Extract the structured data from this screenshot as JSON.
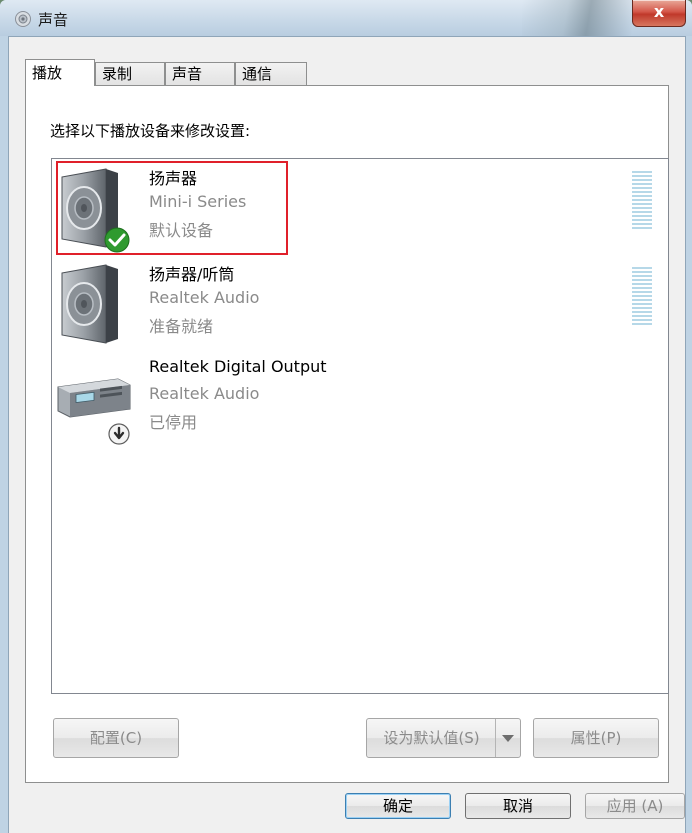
{
  "window": {
    "title": "声音",
    "close_label": "x"
  },
  "tabs": [
    {
      "label": "播放",
      "active": true
    },
    {
      "label": "录制",
      "active": false
    },
    {
      "label": "声音",
      "active": false
    },
    {
      "label": "通信",
      "active": false
    }
  ],
  "instruction": "选择以下播放设备来修改设置:",
  "devices": [
    {
      "name": "扬声器",
      "driver": "Mini-i Series",
      "status": "默认设备",
      "icon": "speaker-icon",
      "badge": "checkmark-icon",
      "selected": true
    },
    {
      "name": "扬声器/听筒",
      "driver": "Realtek Audio",
      "status": "准备就绪",
      "icon": "speaker-icon",
      "badge": null,
      "selected": false
    },
    {
      "name": "Realtek Digital Output",
      "driver": "Realtek Audio",
      "status": "已停用",
      "icon": "digital-output-icon",
      "badge": "disabled-arrow-icon",
      "selected": false
    }
  ],
  "panel_buttons": {
    "configure": "配置(C)",
    "set_default": "设为默认值(S)",
    "properties": "属性(P)"
  },
  "dialog_buttons": {
    "ok": "确定",
    "cancel": "取消",
    "apply": "应用 (A)"
  },
  "colors": {
    "selection_outline": "#e0202a",
    "meter_bar": "#b6d8e8",
    "status_text": "#8a8a8a",
    "default_badge": "#2f9a2f"
  }
}
